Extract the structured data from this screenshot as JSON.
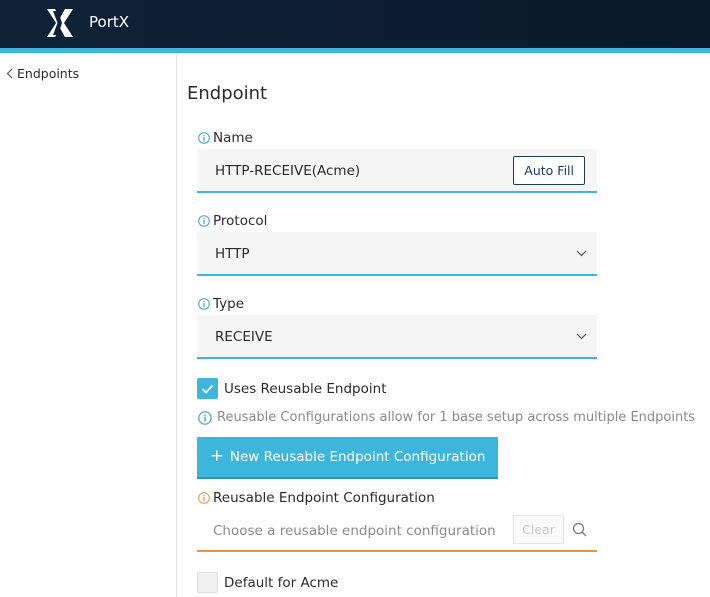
{
  "app": {
    "title": "PortX"
  },
  "sidebar": {
    "back_label": "Endpoints"
  },
  "page": {
    "title": "Endpoint"
  },
  "name_field": {
    "label": "Name",
    "value": "HTTP-RECEIVE(Acme)",
    "autofill_label": "Auto Fill"
  },
  "protocol_field": {
    "label": "Protocol",
    "value": "HTTP"
  },
  "type_field": {
    "label": "Type",
    "value": "RECEIVE"
  },
  "reusable": {
    "checkbox_label": "Uses Reusable Endpoint",
    "checked": true,
    "hint": "Reusable Configurations allow for 1 base setup across multiple Endpoints",
    "new_button_label": "New Reusable Endpoint Configuration",
    "config_label": "Reusable Endpoint Configuration",
    "config_placeholder": "Choose a reusable endpoint configuration",
    "clear_label": "Clear"
  },
  "default_checkbox": {
    "label": "Default for Acme",
    "checked": false
  },
  "colors": {
    "accent": "#3cb6dc",
    "navy": "#0f2338",
    "warning": "#ec9147"
  }
}
